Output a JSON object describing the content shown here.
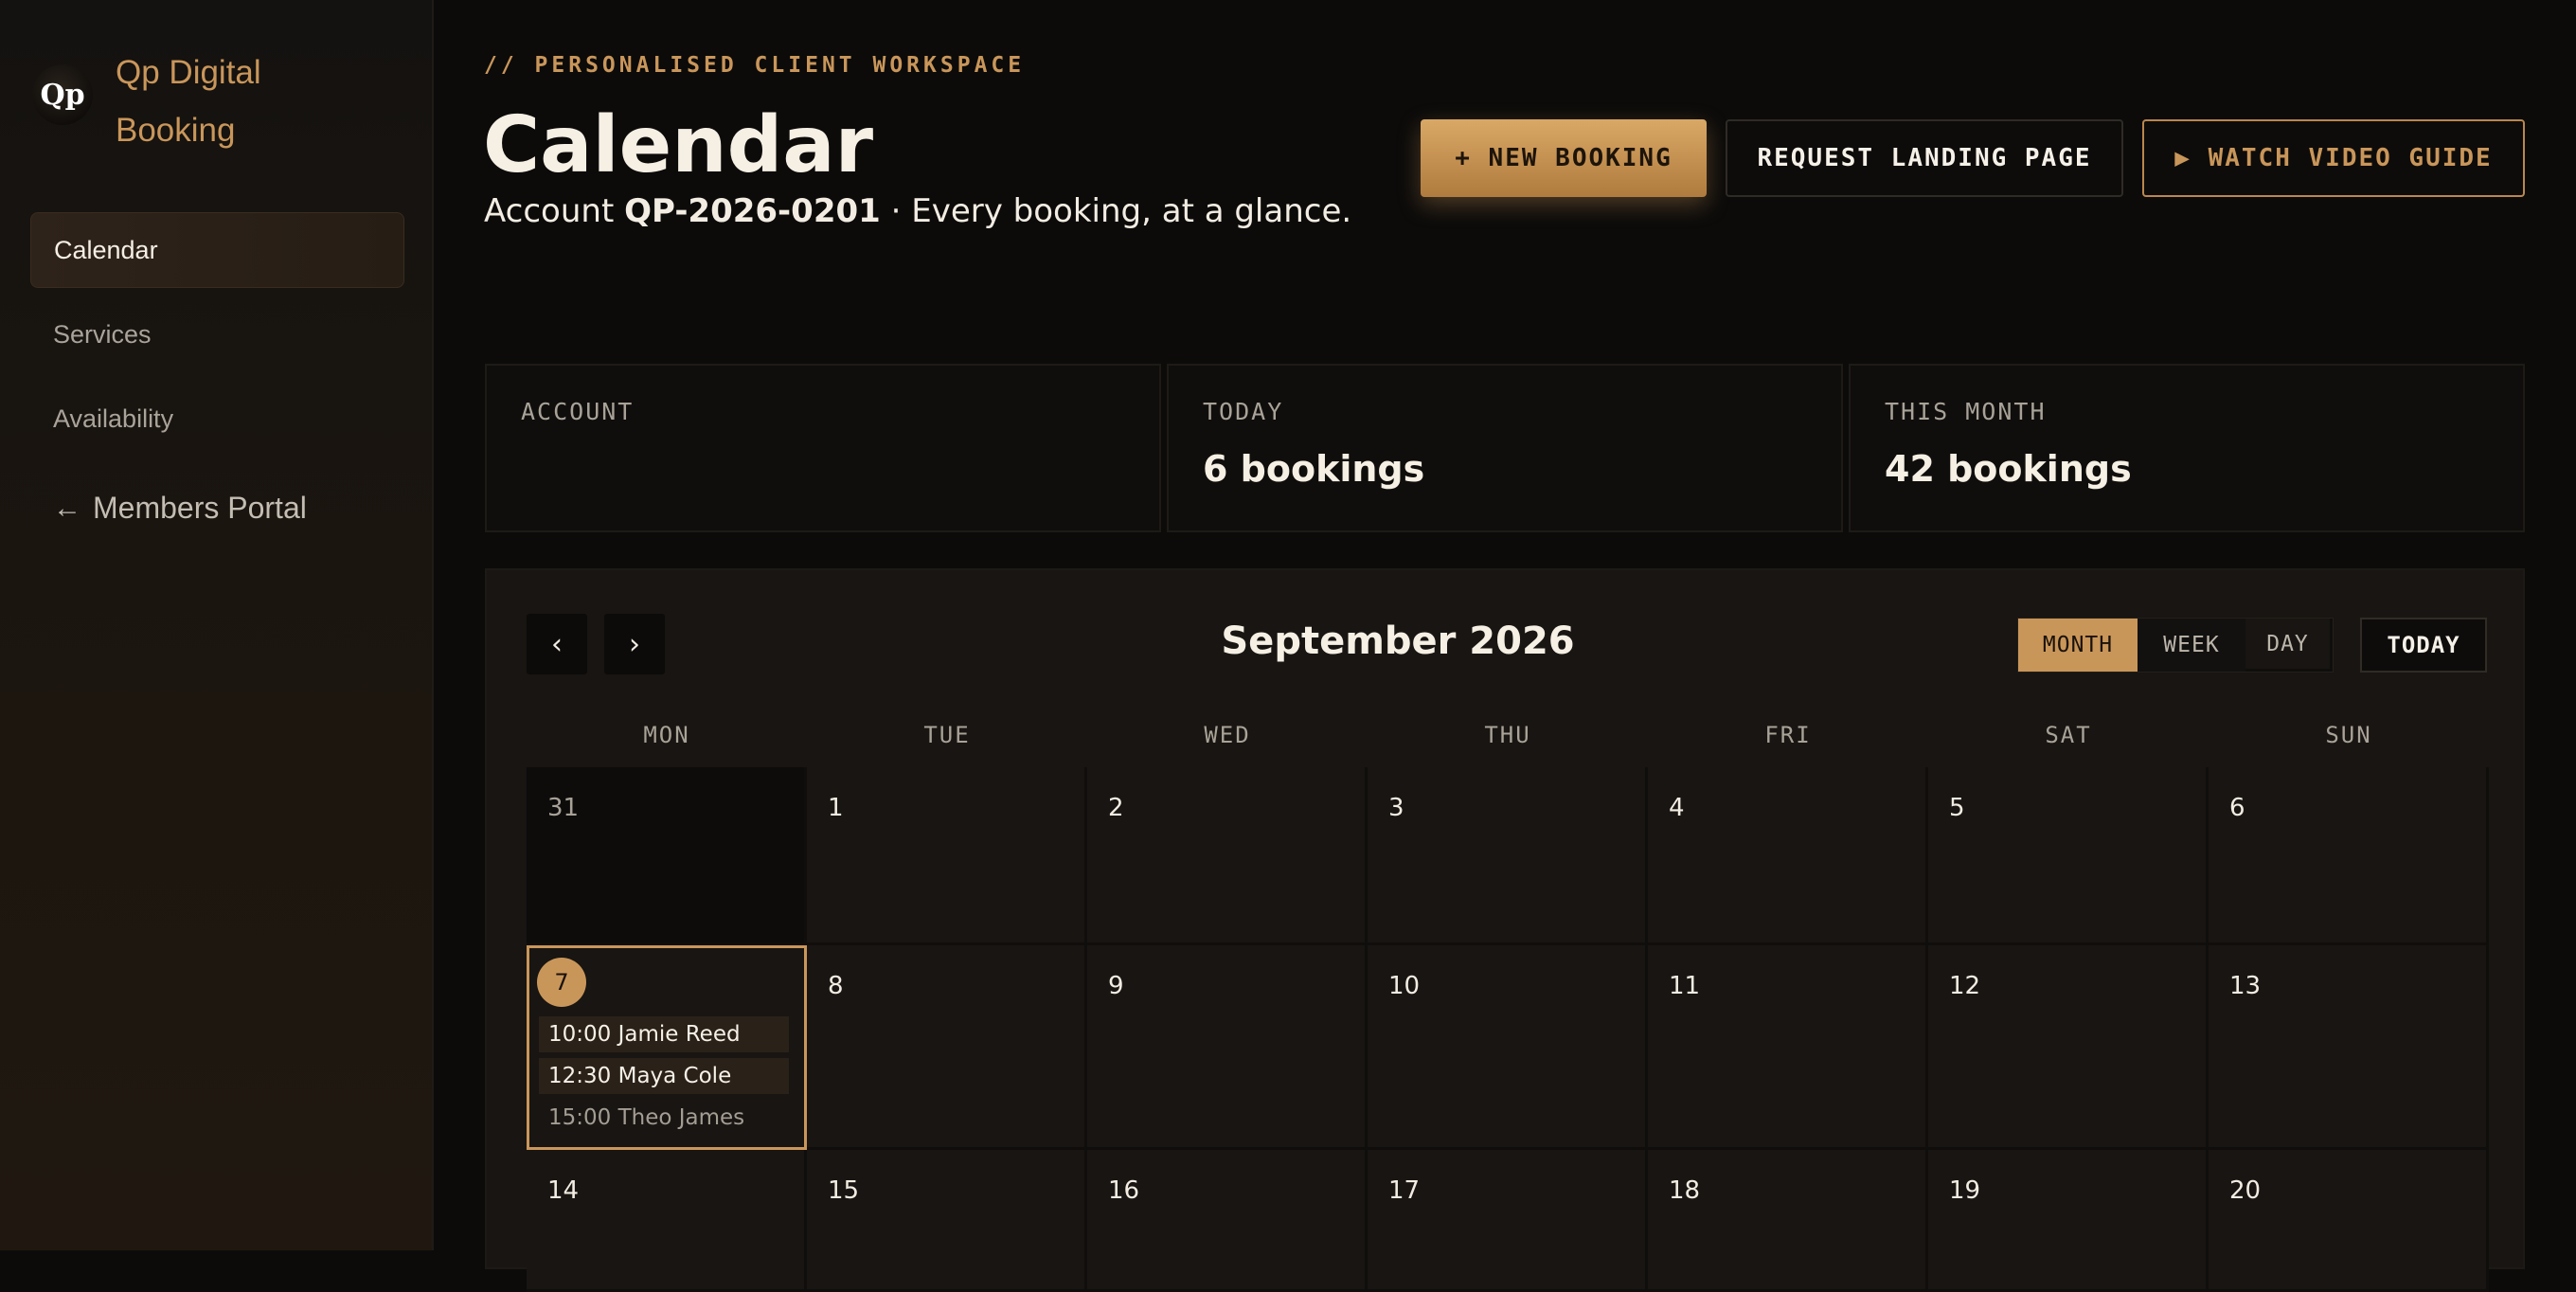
{
  "brand": {
    "logo": "Qp",
    "name": "Qp Digital Booking"
  },
  "sidebar": {
    "items": [
      {
        "label": "Calendar",
        "active": true
      },
      {
        "label": "Services",
        "active": false
      },
      {
        "label": "Availability",
        "active": false
      }
    ],
    "members_portal": {
      "arrow": "←",
      "label": "Members Portal"
    }
  },
  "header": {
    "eyebrow": "// PERSONALISED CLIENT WORKSPACE",
    "title": "Calendar",
    "subtitle_prefix": "Account ",
    "account_id": "QP-2026-0201",
    "subtitle_suffix": " · Every booking, at a glance."
  },
  "actions": {
    "new_booking": "+ NEW BOOKING",
    "landing_page": "REQUEST LANDING PAGE",
    "video_guide": "▶ WATCH VIDEO GUIDE"
  },
  "stats": [
    {
      "label": "ACCOUNT",
      "value": ""
    },
    {
      "label": "TODAY",
      "value": "6 bookings"
    },
    {
      "label": "THIS MONTH",
      "value": "42 bookings"
    }
  ],
  "calendar": {
    "prev": "‹",
    "next": "›",
    "month_title": "September 2026",
    "views": [
      "MONTH",
      "WEEK",
      "DAY"
    ],
    "active_view": "MONTH",
    "today_label": "TODAY",
    "weekdays": [
      "MON",
      "TUE",
      "WED",
      "THU",
      "FRI",
      "SAT",
      "SUN"
    ],
    "weeks": [
      [
        "31",
        "1",
        "2",
        "3",
        "4",
        "5",
        "6"
      ],
      [
        "7",
        "8",
        "9",
        "10",
        "11",
        "12",
        "13"
      ],
      [
        "14",
        "15",
        "16",
        "17",
        "18",
        "19",
        "20"
      ]
    ],
    "events_day_7": [
      "10:00 Jamie Reed",
      "12:30 Maya Cole",
      "15:00 Theo James"
    ]
  },
  "colors": {
    "accent": "#c9965a",
    "background": "#0c0b0a",
    "panel": "#181512"
  }
}
